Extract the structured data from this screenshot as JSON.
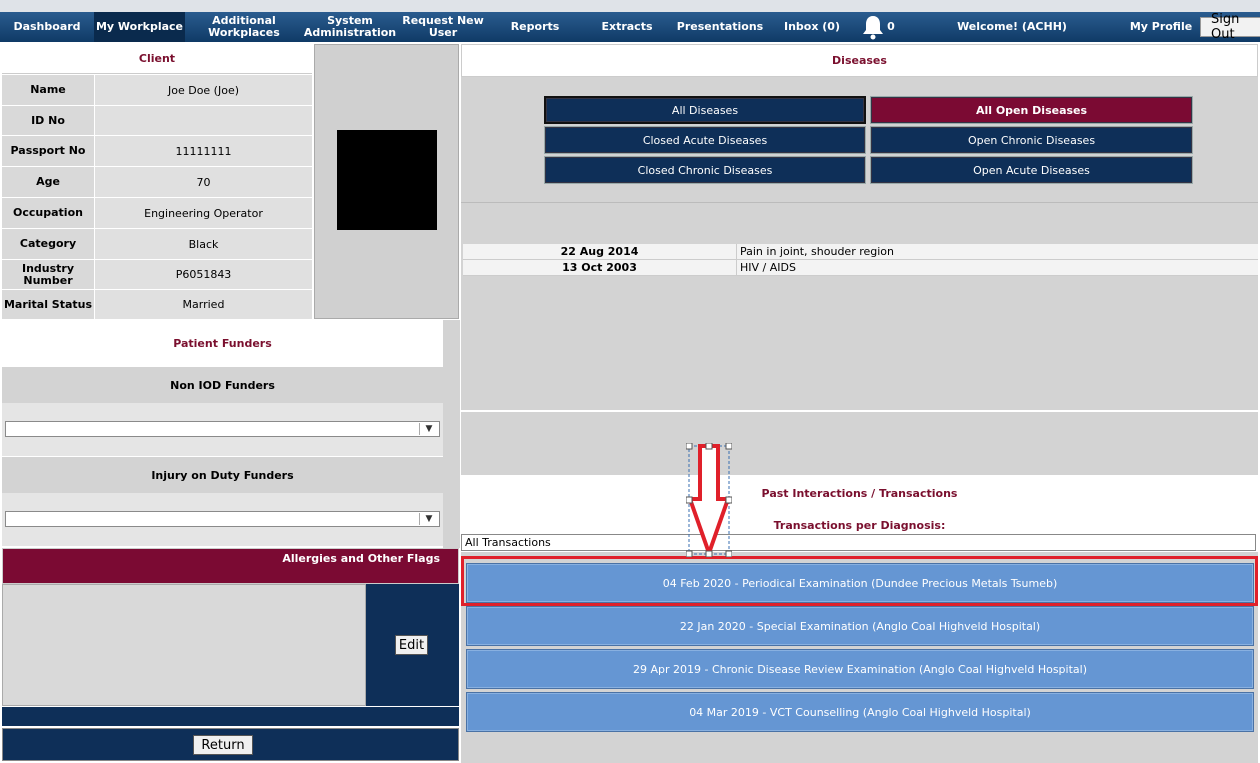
{
  "nav": {
    "items": [
      {
        "label": "Dashboard"
      },
      {
        "label": "My Workplace"
      },
      {
        "label": "Additional Workplaces"
      },
      {
        "label": "System Administration"
      },
      {
        "label": "Request New User"
      },
      {
        "label": "Reports"
      },
      {
        "label": "Extracts"
      },
      {
        "label": "Presentations"
      },
      {
        "label": "Inbox (0)"
      }
    ],
    "bell_count": "0",
    "welcome": "Welcome! (ACHH)",
    "profile": "My Profile",
    "signout": "Sign Out"
  },
  "client": {
    "title": "Client",
    "fields": [
      {
        "label": "Name",
        "value": "Joe Doe (Joe)"
      },
      {
        "label": "ID No",
        "value": ""
      },
      {
        "label": "Passport No",
        "value": "11111111"
      },
      {
        "label": "Age",
        "value": "70"
      },
      {
        "label": "Occupation",
        "value": "Engineering Operator"
      },
      {
        "label": "Category",
        "value": "Black"
      },
      {
        "label": "Industry Number",
        "value": "P6051843"
      },
      {
        "label": "Marital Status",
        "value": "Married"
      }
    ]
  },
  "funders": {
    "title": "Patient Funders",
    "non_iod": "Non IOD Funders",
    "non_iod_value": "",
    "iod": "Injury on Duty Funders",
    "iod_value": ""
  },
  "allergies": {
    "title": "Allergies and Other Flags",
    "edit": "Edit"
  },
  "return_label": "Return",
  "diseases": {
    "title": "Diseases",
    "buttons": [
      {
        "label": "All Diseases"
      },
      {
        "label": "All Open Diseases"
      },
      {
        "label": "Closed Acute Diseases"
      },
      {
        "label": "Open Chronic Diseases"
      },
      {
        "label": "Closed Chronic Diseases"
      },
      {
        "label": "Open Acute Diseases"
      }
    ],
    "rows": [
      {
        "date": "22 Aug 2014",
        "desc": "Pain in joint, shouder region"
      },
      {
        "date": "13 Oct 2003",
        "desc": "HIV / AIDS"
      }
    ]
  },
  "transactions": {
    "title": "Past Interactions / Transactions",
    "per_diag": "Transactions per Diagnosis:",
    "filter_value": "All Transactions",
    "rows": [
      {
        "label": "04 Feb 2020 - Periodical Examination (Dundee Precious Metals Tsumeb)"
      },
      {
        "label": "22 Jan 2020 - Special Examination (Anglo Coal Highveld Hospital)"
      },
      {
        "label": "29 Apr 2019 - Chronic Disease Review Examination (Anglo Coal Highveld Hospital)"
      },
      {
        "label": "04 Mar 2019 - VCT Counselling (Anglo Coal Highveld Hospital)"
      }
    ]
  },
  "colors": {
    "nav": "#0f3a66",
    "maroon": "#7b0a33",
    "navy": "#0e2f58",
    "tx_blue": "#6596d3",
    "highlight": "#e0202a"
  }
}
